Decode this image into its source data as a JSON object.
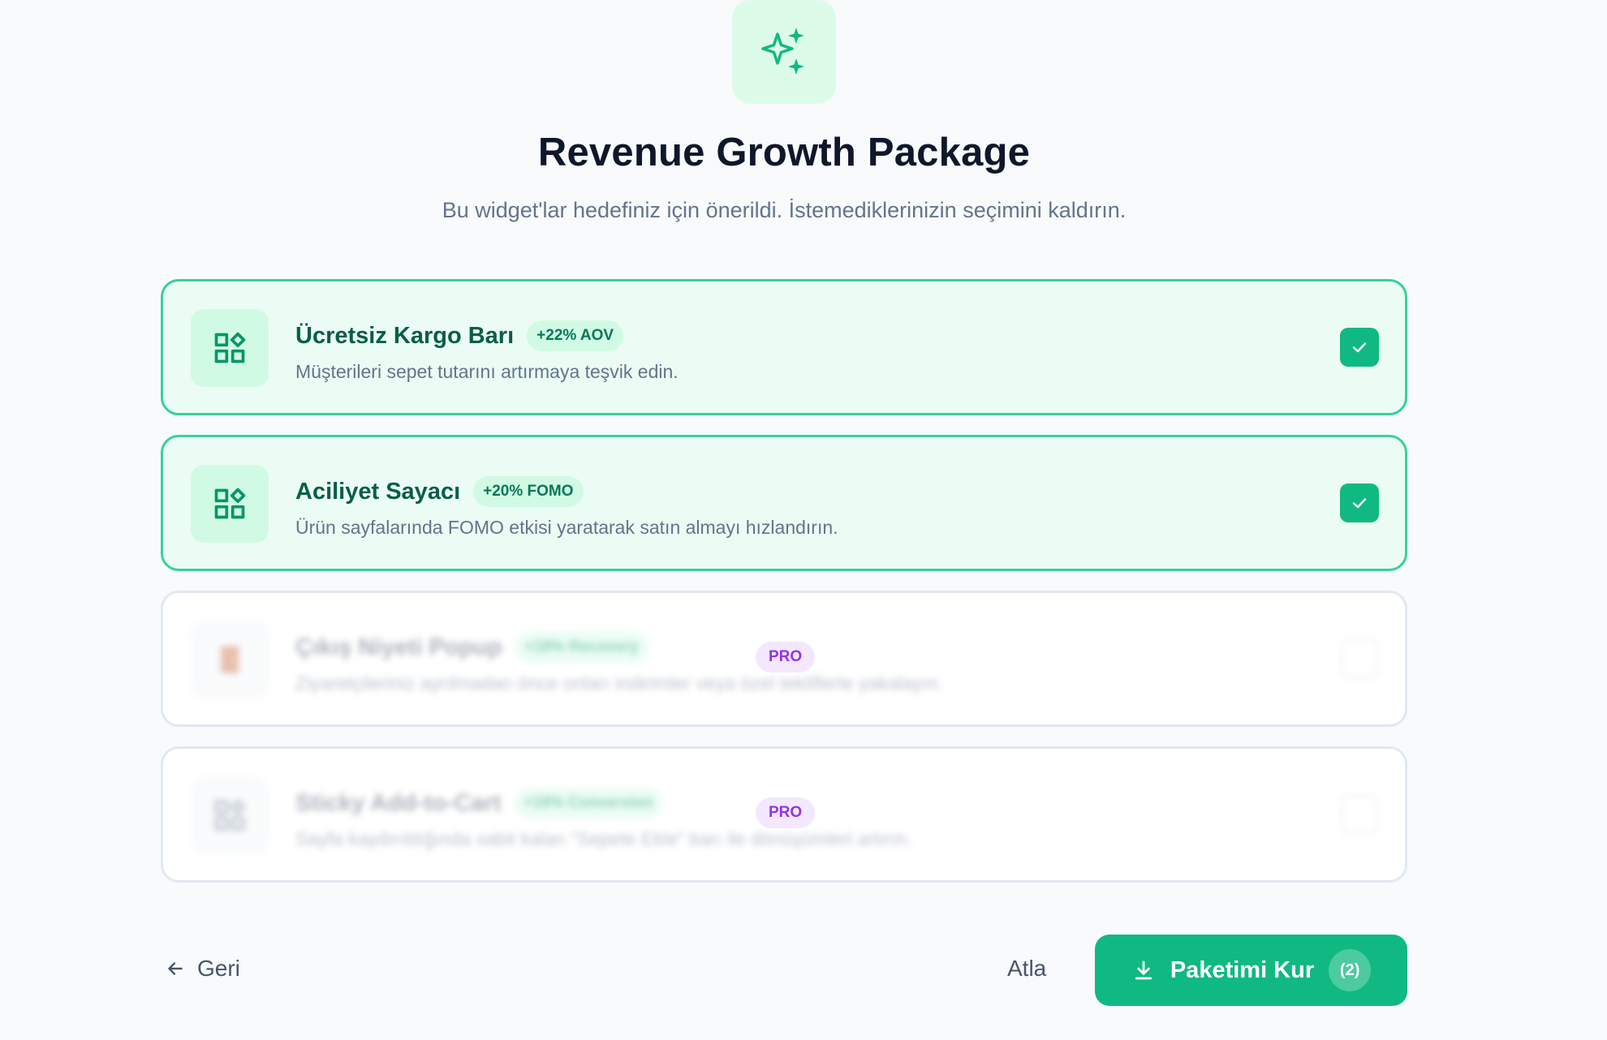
{
  "header": {
    "icon": "sparkles-icon",
    "title": "Revenue Growth Package",
    "subtitle": "Bu widget'lar hedefiniz için önerildi. İstemediklerinizin seçimini kaldırın."
  },
  "widgets": [
    {
      "title": "Ücretsiz Kargo Barı",
      "badge": "+22% AOV",
      "description": "Müşterileri sepet tutarını artırmaya teşvik edin.",
      "icon": "widgets-icon",
      "selected": true
    },
    {
      "title": "Aciliyet Sayacı",
      "badge": "+20% FOMO",
      "description": "Ürün sayfalarında FOMO etkisi yaratarak satın almayı hızlandırın.",
      "icon": "widgets-icon",
      "selected": true
    },
    {
      "title": "Çıkış Niyeti Popup",
      "badge": "+18% Recovery",
      "description": "Ziyaretçileriniz ayrılmadan önce onları indirimler veya özel tekliflerle yakalayın.",
      "icon": "door-icon",
      "selected": false,
      "pro_label": "PRO"
    },
    {
      "title": "Sticky Add-to-Cart",
      "badge": "+18% Conversion",
      "description": "Sayfa kaydırıldığında sabit kalan \"Sepete Ekle\" barı ile dönüşümleri artırın.",
      "icon": "widgets-icon",
      "selected": false,
      "pro_label": "PRO"
    }
  ],
  "footer": {
    "back_label": "Geri",
    "skip_label": "Atla",
    "install_label": "Paketimi Kur",
    "install_count": "(2)"
  },
  "colors": {
    "accent": "#10b981",
    "accent_light": "#d1fae5",
    "pro": "#9333ea"
  }
}
